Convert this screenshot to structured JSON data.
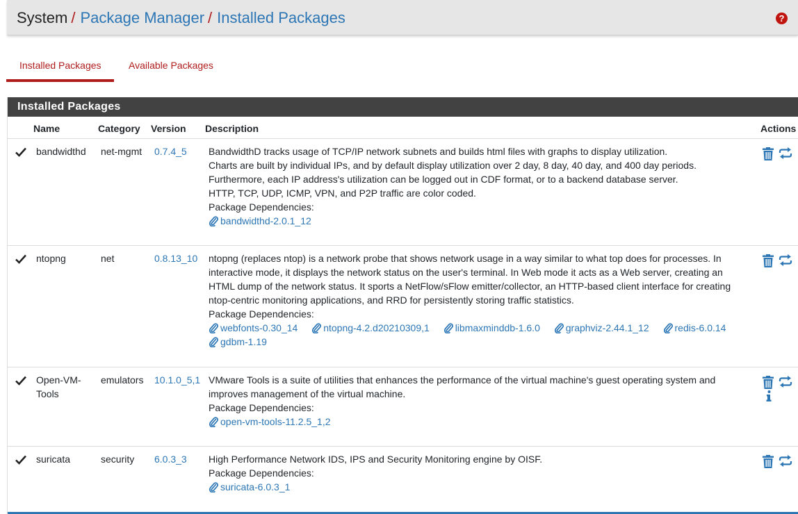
{
  "breadcrumb": {
    "items": [
      "System",
      "Package Manager",
      "Installed Packages"
    ],
    "separator": "/"
  },
  "help_icon": "question-circle-icon",
  "tabs": [
    {
      "label": "Installed Packages",
      "active": true
    },
    {
      "label": "Available Packages",
      "active": false
    }
  ],
  "panel": {
    "title": "Installed Packages",
    "columns": [
      "Name",
      "Category",
      "Version",
      "Description",
      "Actions"
    ]
  },
  "packages": [
    {
      "name": "bandwidthd",
      "category": "net-mgmt",
      "version": "0.7.4_5",
      "description": [
        "BandwidthD tracks usage of TCP/IP network subnets and builds html files with graphs to display utilization.",
        "Charts are built by individual IPs, and by default display utilization over 2 day, 8 day, 40 day, and 400 day periods. Furthermore, each IP address's utilization can be logged out in CDF format, or to a backend database server.",
        "HTTP, TCP, UDP, ICMP, VPN, and P2P traffic are color coded."
      ],
      "dependencies_label": "Package Dependencies:",
      "dependencies": [
        "bandwidthd-2.0.1_12"
      ],
      "actions": [
        "trash-icon",
        "reinstall-icon"
      ]
    },
    {
      "name": "ntopng",
      "category": "net",
      "version": "0.8.13_10",
      "description": [
        "ntopng (replaces ntop) is a network probe that shows network usage in a way similar to what top does for processes. In interactive mode, it displays the network status on the user's terminal. In Web mode it acts as a Web server, creating an HTML dump of the network status. It sports a NetFlow/sFlow emitter/collector, an HTTP-based client interface for creating ntop-centric monitoring applications, and RRD for persistently storing traffic statistics."
      ],
      "dependencies_label": "Package Dependencies:",
      "dependencies": [
        "webfonts-0.30_14",
        "ntopng-4.2.d20210309,1",
        "libmaxminddb-1.6.0",
        "graphviz-2.44.1_12",
        "redis-6.0.14",
        "gdbm-1.19"
      ],
      "actions": [
        "trash-icon",
        "reinstall-icon"
      ]
    },
    {
      "name": "Open-VM-Tools",
      "category": "emulators",
      "version": "10.1.0_5,1",
      "description": [
        "VMware Tools is a suite of utilities that enhances the performance of the virtual machine's guest operating system and improves management of the virtual machine."
      ],
      "dependencies_label": "Package Dependencies:",
      "dependencies": [
        "open-vm-tools-11.2.5_1,2"
      ],
      "actions": [
        "trash-icon",
        "reinstall-icon",
        "info-icon"
      ]
    },
    {
      "name": "suricata",
      "category": "security",
      "version": "6.0.3_3",
      "description": [
        "High Performance Network IDS, IPS and Security Monitoring engine by OISF."
      ],
      "dependencies_label": "Package Dependencies:",
      "dependencies": [
        "suricata-6.0.3_1"
      ],
      "actions": [
        "trash-icon",
        "reinstall-icon"
      ]
    }
  ],
  "colors": {
    "link": "#2c76b5",
    "accent": "#b01c1c",
    "header_bg": "#424242",
    "topbar_bg": "#e6e6e6"
  }
}
